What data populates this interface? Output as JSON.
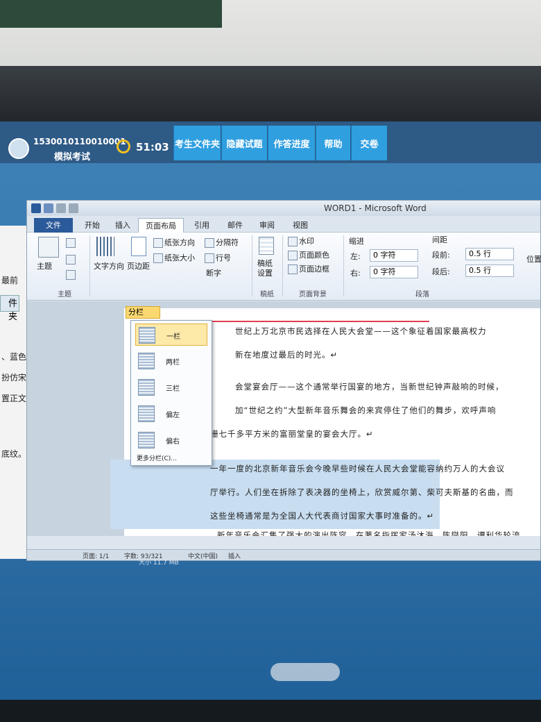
{
  "exam": {
    "user_id": "1530010110010001",
    "mode": "模拟考试",
    "timer": "51:03",
    "buttons": [
      "考生文件夹",
      "隐藏试题",
      "作答进度",
      "帮助",
      "交卷"
    ]
  },
  "left_panel": {
    "lines": [
      "最前",
      "件夹",
      "、蓝色、",
      "扮仿宋",
      "置正文第四",
      "底纹。"
    ]
  },
  "word": {
    "title": "WORD1 - Microsoft Word",
    "tabs": [
      "文件",
      "开始",
      "插入",
      "页面布局",
      "引用",
      "邮件",
      "审阅",
      "视图"
    ],
    "active_tab": "页面布局",
    "ribbon": {
      "theme": "主题",
      "text_direction": "文字方向",
      "margins": "页边距",
      "orientation": "纸张方向",
      "size": "纸张大小",
      "columns": "分栏",
      "breaks": "分隔符",
      "line_numbers": "行号",
      "hyphenation": "断字",
      "manuscript": "稿纸设置",
      "watermark": "水印",
      "page_color": "页面颜色",
      "page_border": "页面边框",
      "indent_label": "缩进",
      "indent_left_label": "左:",
      "indent_left_value": "0 字符",
      "indent_right_label": "右:",
      "indent_right_value": "0 字符",
      "spacing_label": "间距",
      "spacing_before_label": "段前:",
      "spacing_before_value": "0.5 行",
      "spacing_after_label": "段后:",
      "spacing_after_value": "0.5 行",
      "position": "位置",
      "group_theme": "主题",
      "group_manuscript": "稿纸",
      "group_page_bg": "页面背景",
      "group_paragraph": "段落"
    },
    "columns_menu": {
      "items": [
        "一栏",
        "两栏",
        "三栏",
        "偏左",
        "偏右"
      ],
      "more": "更多分栏(C)..."
    },
    "document": {
      "lines": [
        "世纪上万北京市民选择在人民大会堂——这个象征着国家最高权力",
        "新在地度过最后的时光。↵",
        "会堂宴会厅——这个通常举行国宴的地方，当新世纪钟声敲响的时候，",
        "加“世纪之约”大型新年音乐舞会的来宾停住了他们的舞步，欢呼声响",
        "栅七千多平方米的富丽堂皇的宴会大厅。↵",
        "一年一度的北京新年音乐会今晚早些时候在人民大会堂能容纳约万人的大会议",
        "厅举行。人们坐在拆除了表决器的坐椅上，欣赏威尔第、柴可夫斯基的名曲，而",
        "这些坐椅通常是为全国人大代表商讨国家大事时准备的。↵",
        "新年音乐会汇集了强大的演出阵容，在著名指挥家汤沐海、陈燮阳、谭利华轮流"
      ]
    },
    "status": {
      "page": "页面: 1/1",
      "words": "字数: 93/321",
      "language": "中文(中国)",
      "mode": "插入"
    }
  },
  "below_info": "大小 11.7 MB"
}
